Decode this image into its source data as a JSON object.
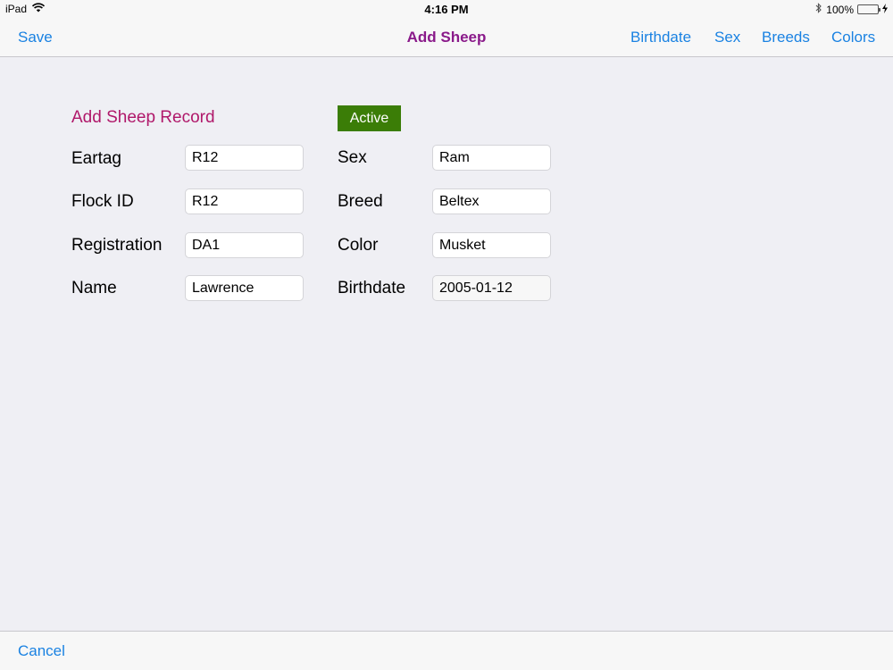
{
  "status_bar": {
    "device": "iPad",
    "time": "4:16 PM",
    "battery": "100%",
    "battery_level": 1.0
  },
  "nav": {
    "title": "Add Sheep",
    "left_button": "Save",
    "right_buttons": [
      "Birthdate",
      "Sex",
      "Breeds",
      "Colors"
    ]
  },
  "form": {
    "heading": "Add Sheep Record",
    "status_badge": "Active",
    "left_fields": [
      {
        "label": "Eartag",
        "value": "R12"
      },
      {
        "label": "Flock ID",
        "value": "R12"
      },
      {
        "label": "Registration",
        "value": "DA1"
      },
      {
        "label": "Name",
        "value": "Lawrence"
      }
    ],
    "right_fields": [
      {
        "label": "Sex",
        "value": "Ram"
      },
      {
        "label": "Breed",
        "value": "Beltex"
      },
      {
        "label": "Color",
        "value": "Musket"
      },
      {
        "label": "Birthdate",
        "value": "2005-01-12"
      }
    ]
  },
  "toolbar": {
    "cancel_label": "Cancel"
  },
  "colors": {
    "accent": "#1a82e2",
    "title": "#8a1a8a",
    "heading": "#b0186a",
    "badge": "#3b7d07"
  }
}
